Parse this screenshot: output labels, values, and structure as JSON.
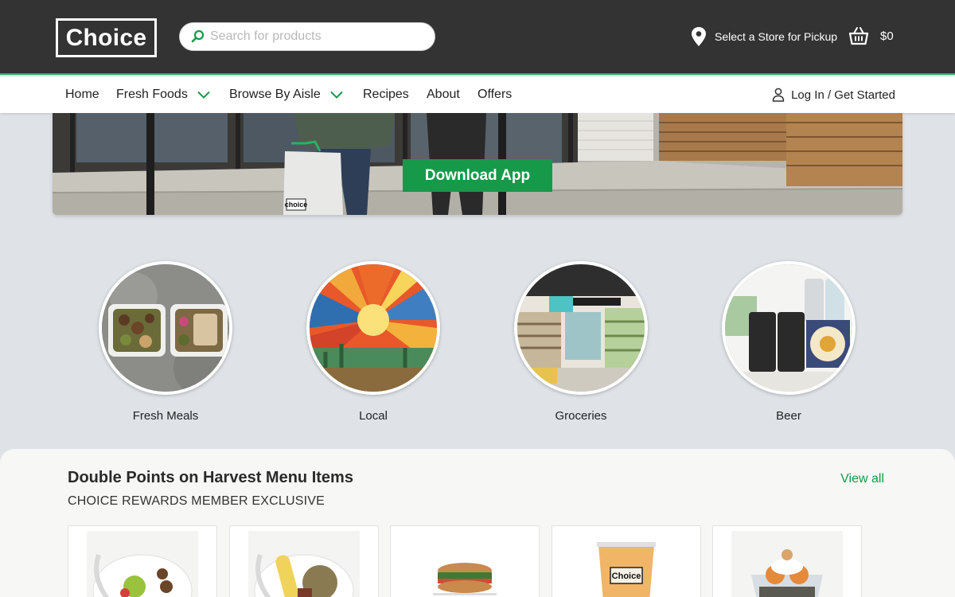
{
  "header": {
    "logo_text": "Choice",
    "search": {
      "placeholder": "Search for products",
      "value": ""
    },
    "store_label": "Select a Store for Pickup",
    "cart_total": "$0"
  },
  "nav": {
    "items": [
      {
        "label": "Home",
        "has_dropdown": false
      },
      {
        "label": "Fresh Foods",
        "has_dropdown": true
      },
      {
        "label": "Browse By Aisle",
        "has_dropdown": true
      },
      {
        "label": "Recipes",
        "has_dropdown": false
      },
      {
        "label": "About",
        "has_dropdown": false
      },
      {
        "label": "Offers",
        "has_dropdown": false
      }
    ],
    "login_label": "Log In / Get Started"
  },
  "hero": {
    "button_label": "Download App",
    "bag_text": "choice"
  },
  "categories": [
    {
      "label": "Fresh Meals"
    },
    {
      "label": "Local"
    },
    {
      "label": "Groceries"
    },
    {
      "label": "Beer"
    }
  ],
  "promo": {
    "title": "Double Points on Harvest Menu Items",
    "subtitle": "CHOICE REWARDS MEMBER EXCLUSIVE",
    "view_all": "View all",
    "cup_text": "Choice"
  },
  "colors": {
    "accent_green": "#17994a",
    "topbar": "#333333",
    "page_bg": "#dfe3e7"
  },
  "icons": [
    "search-icon",
    "map-pin-icon",
    "basket-icon",
    "chevron-down-icon",
    "user-icon"
  ]
}
